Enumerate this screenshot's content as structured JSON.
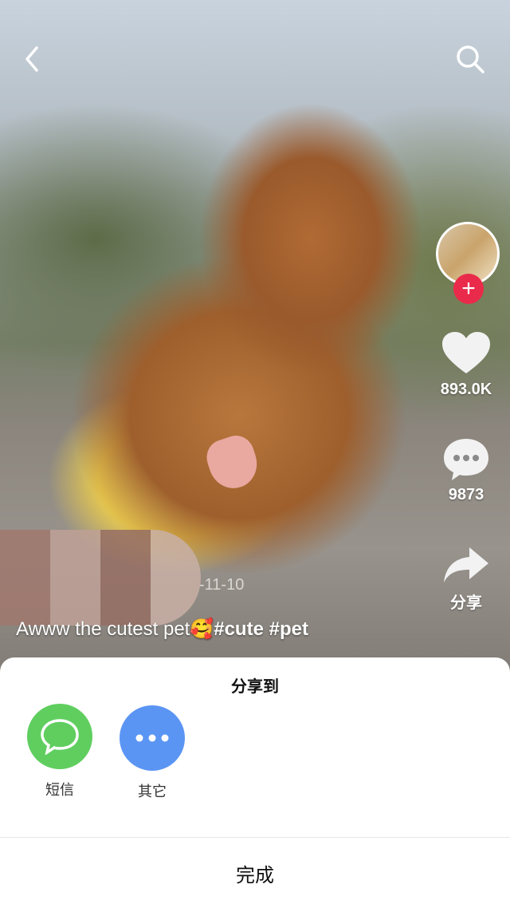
{
  "video": {
    "date_fragment": "-11-10",
    "caption_text": "Awww the cutest pet",
    "caption_emoji": "🥰",
    "caption_tags": "#cute #pet"
  },
  "rail": {
    "like_count": "893.0K",
    "comment_count": "9873",
    "share_label": "分享"
  },
  "share_sheet": {
    "title": "分享到",
    "apps": [
      {
        "label": "短信",
        "icon": "message-bubble-icon",
        "color": "#5fce5f"
      },
      {
        "label": "其它",
        "icon": "more-dots-icon",
        "color": "#5b95f4"
      }
    ],
    "done_label": "完成"
  },
  "colors": {
    "follow_red": "#ea2a4a",
    "sheet_bg": "#ffffff"
  }
}
